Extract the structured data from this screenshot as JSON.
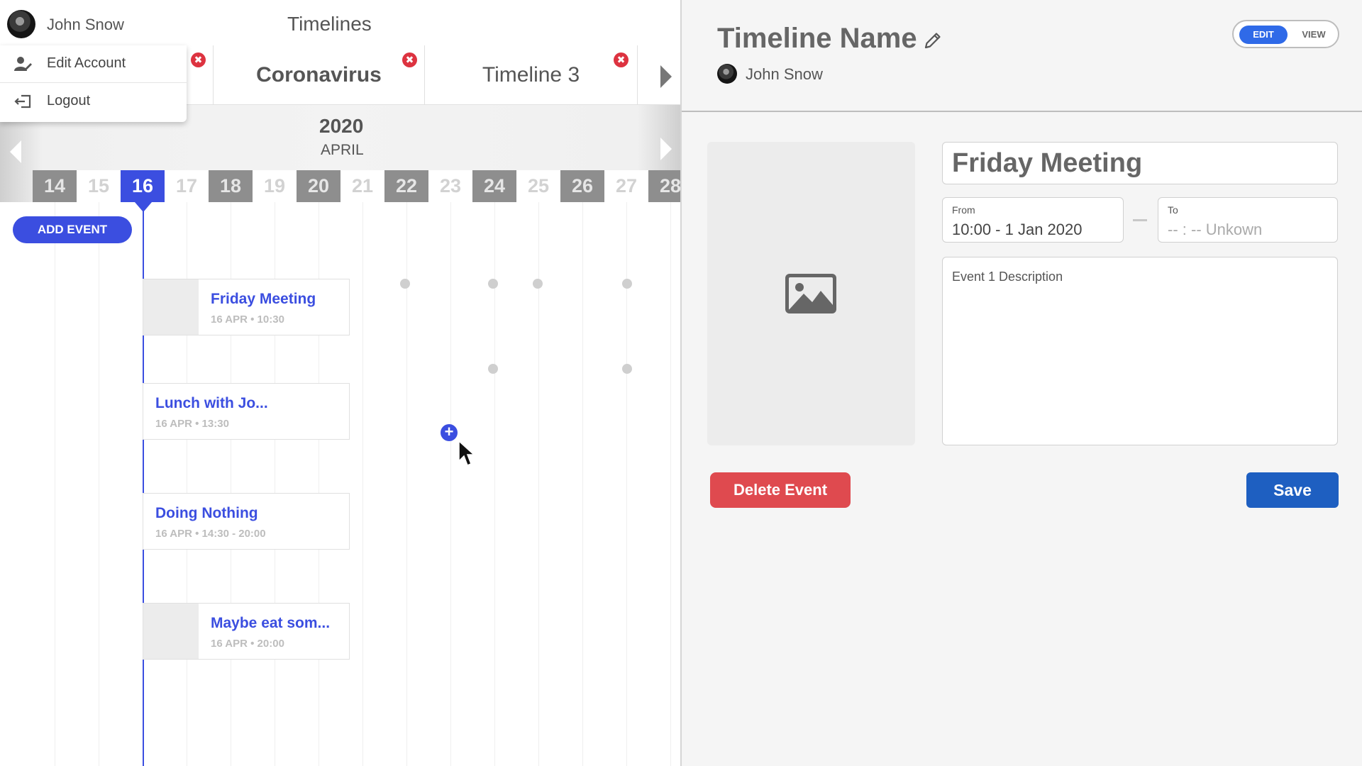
{
  "user": {
    "name": "John Snow"
  },
  "app": {
    "title": "Timelines"
  },
  "account_menu": {
    "items": [
      {
        "label": "Edit Account",
        "icon": "user-edit-icon"
      },
      {
        "label": "Logout",
        "icon": "logout-icon"
      }
    ]
  },
  "tabs": {
    "items": [
      {
        "label": "",
        "active": false
      },
      {
        "label": "Coronavirus",
        "active": true
      },
      {
        "label": "Timeline 3",
        "active": false
      }
    ],
    "close_symbol": "✖"
  },
  "calendar": {
    "year": "2020",
    "month": "APRIL",
    "days": [
      {
        "label": "14",
        "style": "dark"
      },
      {
        "label": "15",
        "style": "light"
      },
      {
        "label": "16",
        "style": "selected"
      },
      {
        "label": "17",
        "style": "light"
      },
      {
        "label": "18",
        "style": "dark"
      },
      {
        "label": "19",
        "style": "light"
      },
      {
        "label": "20",
        "style": "dark"
      },
      {
        "label": "21",
        "style": "light"
      },
      {
        "label": "22",
        "style": "dark"
      },
      {
        "label": "23",
        "style": "light"
      },
      {
        "label": "24",
        "style": "dark"
      },
      {
        "label": "25",
        "style": "light"
      },
      {
        "label": "26",
        "style": "dark"
      },
      {
        "label": "27",
        "style": "light"
      },
      {
        "label": "28",
        "style": "dark"
      }
    ]
  },
  "timeline": {
    "add_event_label": "ADD EVENT",
    "events": [
      {
        "title": "Friday Meeting",
        "meta": "16 APR • 10:30",
        "has_image": true
      },
      {
        "title": "Lunch with Jo...",
        "meta": "16 APR • 13:30",
        "has_image": false
      },
      {
        "title": "Doing Nothing",
        "meta": "16 APR • 14:30 - 20:00",
        "has_image": false
      },
      {
        "title": "Maybe eat som...",
        "meta": "16 APR • 20:00",
        "has_image": true
      }
    ],
    "add_point_symbol": "+"
  },
  "editor": {
    "timeline_name": "Timeline Name",
    "owner": "John Snow",
    "mode_toggle": {
      "edit_label": "EDIT",
      "view_label": "VIEW",
      "selected": "EDIT"
    },
    "event_title": "Friday Meeting",
    "from": {
      "label": "From",
      "value": "10:00 - 1 Jan 2020"
    },
    "to": {
      "label": "To",
      "value": "-- : --  Unkown"
    },
    "description": "Event 1 Description",
    "delete_label": "Delete Event",
    "save_label": "Save"
  },
  "colors": {
    "accent": "#3b4ee0",
    "save_blue": "#1e5fc1",
    "delete_red": "#df4a4f",
    "close_red": "#dd3340",
    "toggle_blue": "#2f6ae8"
  }
}
